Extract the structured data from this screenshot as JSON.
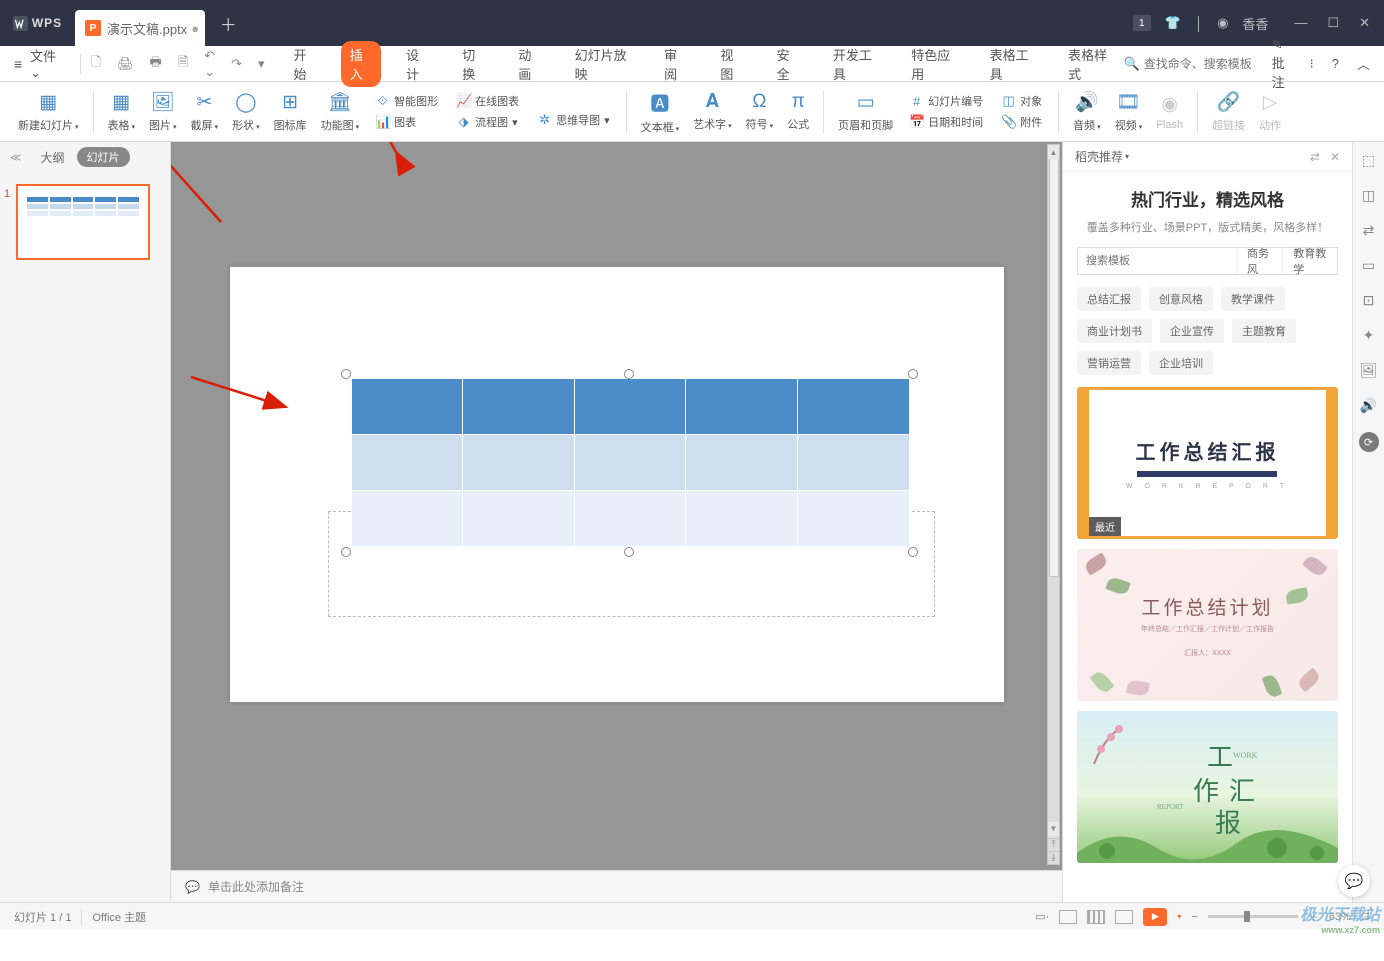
{
  "titlebar": {
    "app": "WPS",
    "tab_name": "演示文稿.pptx",
    "badge": "1",
    "user": "香香"
  },
  "menubar": {
    "file": "文件",
    "tabs": [
      "开始",
      "插入",
      "设计",
      "切换",
      "动画",
      "幻灯片放映",
      "审阅",
      "视图",
      "安全",
      "开发工具",
      "特色应用",
      "表格工具",
      "表格样式"
    ],
    "active_tab": 1,
    "search_placeholder": "查找命令、搜索模板",
    "approve": "批注"
  },
  "ribbon": {
    "new_slide": "新建幻灯片",
    "table": "表格",
    "picture": "图片",
    "screenshot": "截屏",
    "shape": "形状",
    "icon_lib": "图标库",
    "func_chart": "功能图",
    "smart_shape": "智能图形",
    "online_chart": "在线图表",
    "chart": "图表",
    "flowchart": "流程图",
    "mindmap": "思维导图",
    "textbox": "文本框",
    "wordart": "艺术字",
    "symbol": "符号",
    "equation": "公式",
    "header_footer": "页眉和页脚",
    "slide_number": "幻灯片编号",
    "datetime": "日期和时间",
    "object": "对象",
    "attachment": "附件",
    "audio": "音频",
    "video": "视频",
    "flash": "Flash",
    "hyperlink": "超链接",
    "action": "动作"
  },
  "outline": {
    "tab_outline": "大纲",
    "tab_slides": "幻灯片",
    "slide_num": "1"
  },
  "notes": "单击此处添加备注",
  "right_panel": {
    "head": "稻壳推荐",
    "title": "热门行业，精选风格",
    "subtitle": "覆盖多种行业、场景PPT，版式精美，风格多样！",
    "search_placeholder": "搜索模板",
    "search_opts": [
      "商务风",
      "教育教学"
    ],
    "tags": [
      "总结汇报",
      "创意风格",
      "教学课件",
      "商业计划书",
      "企业宣传",
      "主题教育",
      "营销运营",
      "企业培训"
    ],
    "tmpl1_title": "工作总结汇报",
    "tmpl1_sub": "W O R K   R E P O R T",
    "tmpl1_badge": "最近",
    "tmpl2_title": "工作总结计划",
    "tmpl2_sub": "年终总结／工作汇报／工作计划／工作报告",
    "tmpl2_foot": "汇报人：XXXX",
    "tmpl3_a": "工",
    "tmpl3_b": "作",
    "tmpl3_c": "汇",
    "tmpl3_d": "报",
    "tmpl3_e": "WORK",
    "tmpl3_f": "REPORT"
  },
  "statusbar": {
    "slide": "幻灯片 1 / 1",
    "theme": "Office 主题",
    "zoom": "63%"
  },
  "watermark": {
    "a": "极光下载站",
    "b": "www.xz7.com"
  }
}
